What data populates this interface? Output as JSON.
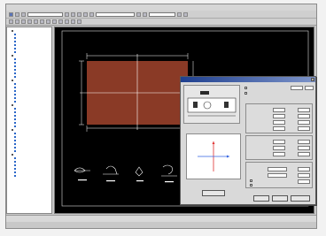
{
  "colors": {
    "canvas_bg": "#000000",
    "slab_fill": "#8a3a26",
    "dimension_line": "#ffffff",
    "dialog_title": "#1e3f8f",
    "axis_red": "#e03030",
    "axis_blue": "#3060e0"
  },
  "icons": {
    "app": "app-icon",
    "tree_node": "folder-icon"
  },
  "tree": {
    "items": [
      "",
      "",
      "",
      "",
      "",
      "",
      "",
      "",
      "",
      "",
      "",
      "",
      "",
      "",
      "",
      "",
      "",
      "",
      "",
      "",
      "",
      "",
      "",
      "",
      "",
      "",
      "",
      "",
      "",
      "",
      "",
      "",
      "",
      "",
      "",
      "",
      "",
      "",
      "",
      "",
      "",
      ""
    ]
  },
  "dialog": {
    "title": "",
    "preview_button": "",
    "ok_button": "",
    "cancel_button": "",
    "help_button": ""
  },
  "status": {
    "text": ""
  }
}
